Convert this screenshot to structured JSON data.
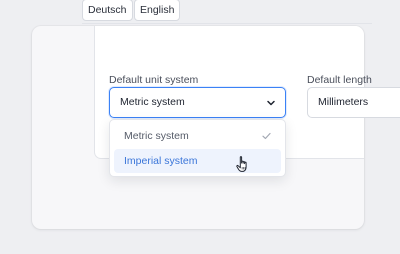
{
  "language": {
    "options": [
      "Deutsch",
      "English"
    ]
  },
  "unit_system": {
    "label": "Default unit system",
    "selected": "Metric system",
    "options": [
      {
        "label": "Metric system",
        "checked": true,
        "hovered": false
      },
      {
        "label": "Imperial system",
        "checked": false,
        "hovered": true
      }
    ]
  },
  "length_unit": {
    "label": "Default length",
    "selected": "Millimeters"
  },
  "colors": {
    "accent": "#3b82f6",
    "hover_bg": "#eef3fd",
    "hover_text": "#3b76d9"
  },
  "icons": {
    "chevron": "chevron-down-icon",
    "check": "check-icon",
    "cursor": "hand-pointer-cursor-icon"
  }
}
